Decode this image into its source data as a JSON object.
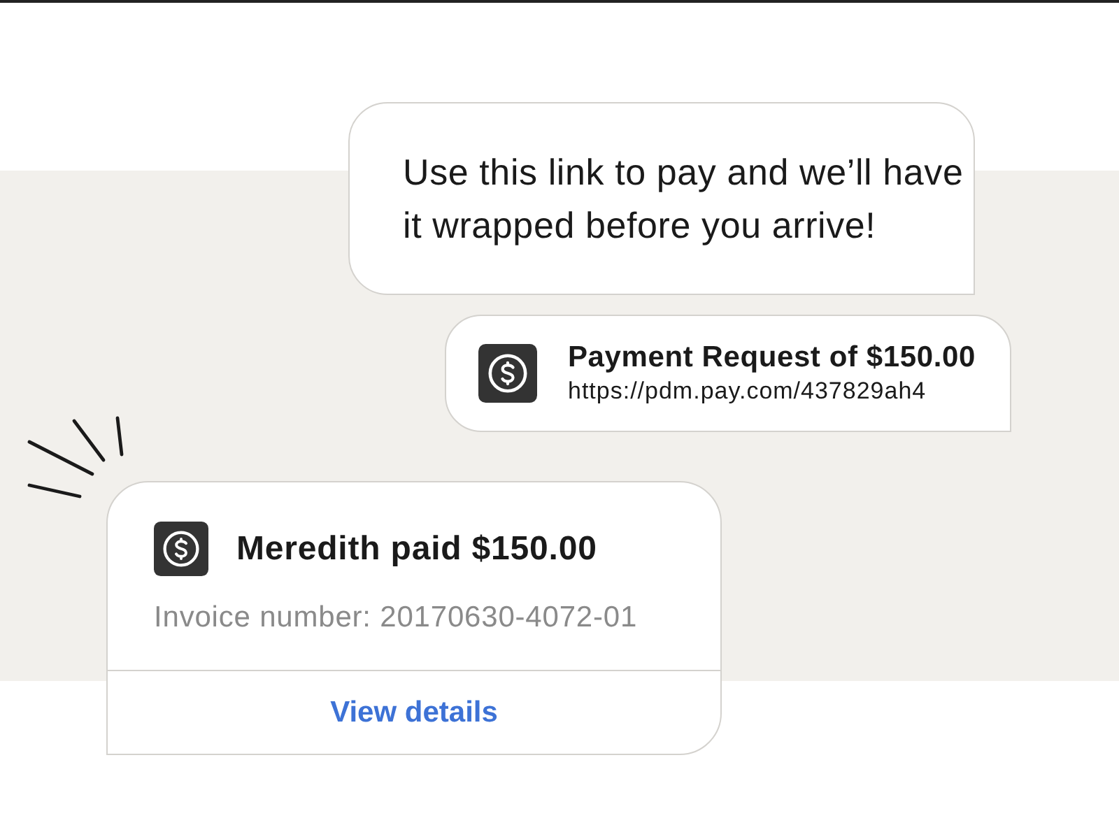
{
  "messages": [
    {
      "kind": "text",
      "text": "Use this link to pay and we’ll have it wrapped before you arrive!"
    },
    {
      "kind": "payment_request",
      "title": "Payment Request of $150.00",
      "url": "https://pdm.pay.com/437829ah4"
    }
  ],
  "payment_card": {
    "title": "Meredith paid $150.00",
    "invoice": "Invoice number: 20170630-4072-01",
    "action": "View details"
  }
}
